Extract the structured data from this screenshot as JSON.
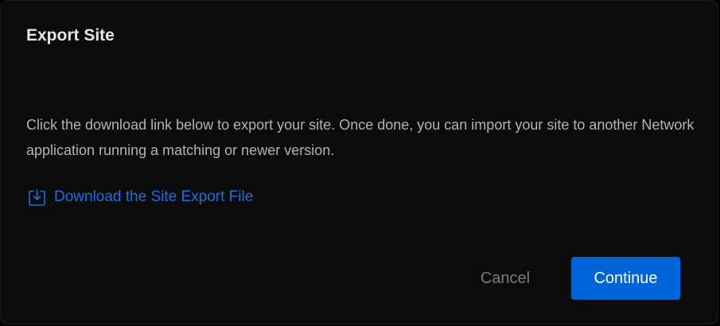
{
  "dialog": {
    "title": "Export Site",
    "description": "Click the download link below to export your site. Once done, you can import your site to another Network application running a matching or newer version.",
    "download_link": {
      "label": "Download the Site Export File",
      "icon": "download-icon"
    },
    "buttons": {
      "cancel_label": "Cancel",
      "continue_label": "Continue"
    }
  },
  "colors": {
    "background": "#0b0b0c",
    "title": "#e6e6e6",
    "body_text": "#b3b3b3",
    "link": "#1a6fe3",
    "primary_button": "#0064d9",
    "secondary_text": "#7b7b7d"
  }
}
